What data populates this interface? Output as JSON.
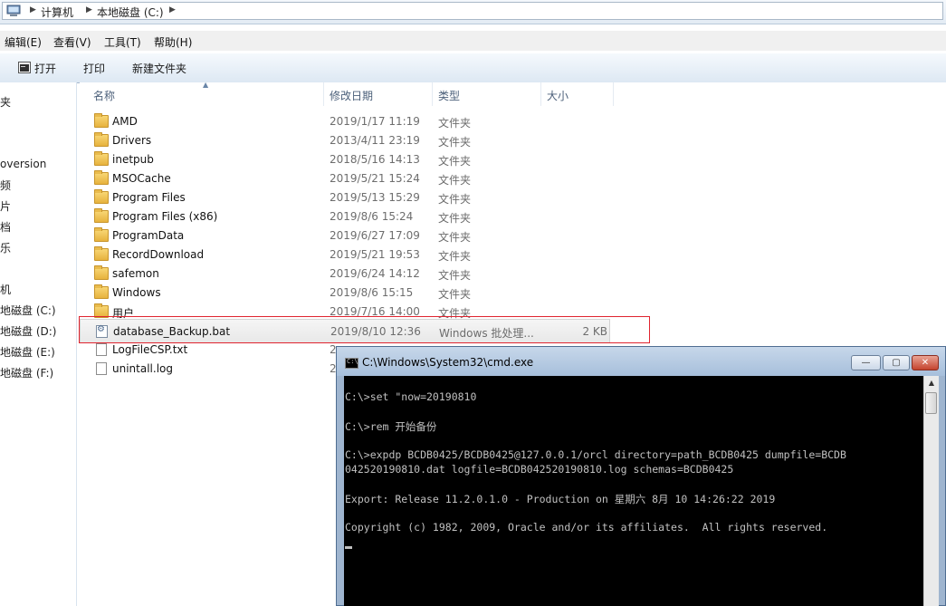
{
  "address": {
    "crumbs": [
      "计算机",
      "本地磁盘 (C:)"
    ]
  },
  "menu": [
    "编辑(E)",
    "查看(V)",
    "工具(T)",
    "帮助(H)"
  ],
  "toolbar": {
    "open": "打开",
    "print": "打印",
    "new_folder": "新建文件夹"
  },
  "nav": {
    "items": [
      "夹",
      "oversion",
      "频",
      "片",
      "档",
      "乐",
      "机",
      "地磁盘 (C:)",
      "地磁盘 (D:)",
      "地磁盘 (E:)",
      "地磁盘 (F:)"
    ]
  },
  "columns": {
    "name": "名称",
    "date": "修改日期",
    "type": "类型",
    "size": "大小"
  },
  "files": [
    {
      "name": "AMD",
      "date": "2019/1/17 11:19",
      "type": "文件夹",
      "size": "",
      "kind": "folder"
    },
    {
      "name": "Drivers",
      "date": "2013/4/11 23:19",
      "type": "文件夹",
      "size": "",
      "kind": "folder"
    },
    {
      "name": "inetpub",
      "date": "2018/5/16 14:13",
      "type": "文件夹",
      "size": "",
      "kind": "folder"
    },
    {
      "name": "MSOCache",
      "date": "2019/5/21 15:24",
      "type": "文件夹",
      "size": "",
      "kind": "folder"
    },
    {
      "name": "Program Files",
      "date": "2019/5/13 15:29",
      "type": "文件夹",
      "size": "",
      "kind": "folder"
    },
    {
      "name": "Program Files (x86)",
      "date": "2019/8/6 15:24",
      "type": "文件夹",
      "size": "",
      "kind": "folder"
    },
    {
      "name": "ProgramData",
      "date": "2019/6/27 17:09",
      "type": "文件夹",
      "size": "",
      "kind": "folder"
    },
    {
      "name": "RecordDownload",
      "date": "2019/5/21 19:53",
      "type": "文件夹",
      "size": "",
      "kind": "folder"
    },
    {
      "name": "safemon",
      "date": "2019/6/24 14:12",
      "type": "文件夹",
      "size": "",
      "kind": "folder"
    },
    {
      "name": "Windows",
      "date": "2019/8/6 15:15",
      "type": "文件夹",
      "size": "",
      "kind": "folder"
    },
    {
      "name": "用户",
      "date": "2019/7/16 14:00",
      "type": "文件夹",
      "size": "",
      "kind": "folder"
    },
    {
      "name": "database_Backup.bat",
      "date": "2019/8/10 12:36",
      "type": "Windows 批处理...",
      "size": "2 KB",
      "kind": "bat"
    },
    {
      "name": "LogFileCSP.txt",
      "date": "2",
      "type": "",
      "size": "",
      "kind": "txt"
    },
    {
      "name": "unintall.log",
      "date": "2",
      "type": "",
      "size": "",
      "kind": "txt"
    }
  ],
  "cmd": {
    "title": "C:\\Windows\\System32\\cmd.exe",
    "icon_text": "C:\\",
    "buttons": {
      "minimize": "—",
      "maximize": "▢",
      "close": "✕"
    },
    "lines": [
      "C:\\>set \"now=20190810",
      "C:\\>rem 开始备份",
      "C:\\>expdp BCDB0425/BCDB0425@127.0.0.1/orcl directory=path_BCDB0425 dumpfile=BCDB",
      "042520190810.dat logfile=BCDB042520190810.log schemas=BCDB0425",
      "Export: Release 11.2.0.1.0 - Production on 星期六 8月 10 14:26:22 2019",
      "Copyright (c) 1982, 2009, Oracle and/or its affiliates.  All rights reserved."
    ]
  },
  "colors": {
    "highlight_border": "#e0242f",
    "console_bg": "#000000",
    "console_text": "#c0c0c0"
  }
}
